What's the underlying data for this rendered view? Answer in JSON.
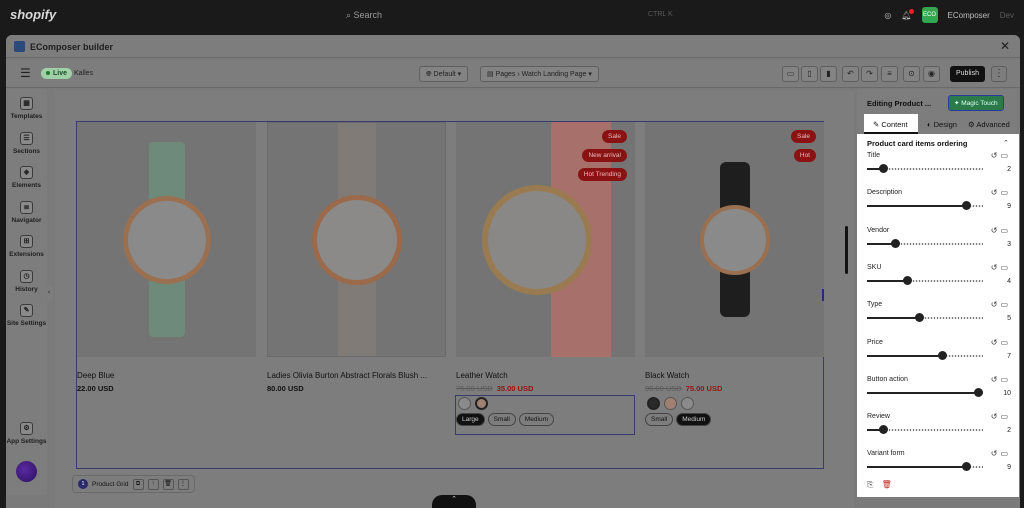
{
  "topbar": {
    "brand": "shopify",
    "search_placeholder": "Search",
    "shortcut": "CTRL K",
    "store_initials": "ECO",
    "store_name": "EComposer",
    "store_suffix": "Dev"
  },
  "window": {
    "title": "EComposer builder"
  },
  "toolbar": {
    "status": "Live",
    "theme": "Kalles",
    "language": "Default",
    "page_prefix": "Pages",
    "page_name": "Watch Landing Page",
    "publish": "Publish"
  },
  "sidebar": {
    "items": [
      {
        "label": "Templates"
      },
      {
        "label": "Sections"
      },
      {
        "label": "Elements"
      },
      {
        "label": "Navigator"
      },
      {
        "label": "Extensions"
      },
      {
        "label": "History"
      },
      {
        "label": "Site Settings"
      }
    ],
    "app_settings": "App Settings"
  },
  "products": [
    {
      "name": "Deep Blue",
      "price": "22.00 USD",
      "old_price": "",
      "badges": [],
      "dial": "#8a8a8a",
      "strap": "#6d8a7a"
    },
    {
      "name": "Ladies Olivia Burton Abstract Florals Blush ...",
      "price": "80.00 USD",
      "old_price": "",
      "badges": [],
      "dial": "#8c8a88",
      "strap": "#807b76"
    },
    {
      "name": "Leather Watch",
      "price": "35.00 USD",
      "old_price": "75.00 USD",
      "badges": [
        "Sale",
        "New arrival",
        "Hot Trending"
      ],
      "dial": "#8a8886",
      "strap": "#a8706a"
    },
    {
      "name": "Black Watch",
      "price": "75.00 USD",
      "old_price": "95.00 USD",
      "badges": [
        "Sale",
        "Hot"
      ],
      "dial": "#8a8a8a",
      "strap": "#1e1e1e"
    }
  ],
  "variants": {
    "leather": {
      "sizes": [
        "Large",
        "Small",
        "Medium"
      ],
      "selected": "Large"
    },
    "black": {
      "sizes": [
        "Small",
        "Medium"
      ],
      "selected": "Medium"
    }
  },
  "bottom": {
    "number": "1",
    "label": "Product Grid"
  },
  "panel": {
    "title": "Editing Product ...",
    "magic": "Magic Touch",
    "tabs": {
      "content": "Content",
      "design": "Design",
      "advanced": "Advanced"
    },
    "section": "Product card items ordering",
    "sliders": [
      {
        "label": "Title",
        "value": 2,
        "display": "2"
      },
      {
        "label": "Description",
        "value": 9,
        "display": "9"
      },
      {
        "label": "Vendor",
        "value": 3,
        "display": "3"
      },
      {
        "label": "SKU",
        "value": 4,
        "display": "4"
      },
      {
        "label": "Type",
        "value": 5,
        "display": "5"
      },
      {
        "label": "Price",
        "value": 7,
        "display": "7"
      },
      {
        "label": "Button action",
        "value": 10,
        "display": "10"
      },
      {
        "label": "Review",
        "value": 2,
        "display": "2"
      },
      {
        "label": "Variant form",
        "value": 9,
        "display": "9"
      }
    ],
    "slider_max": 10
  }
}
